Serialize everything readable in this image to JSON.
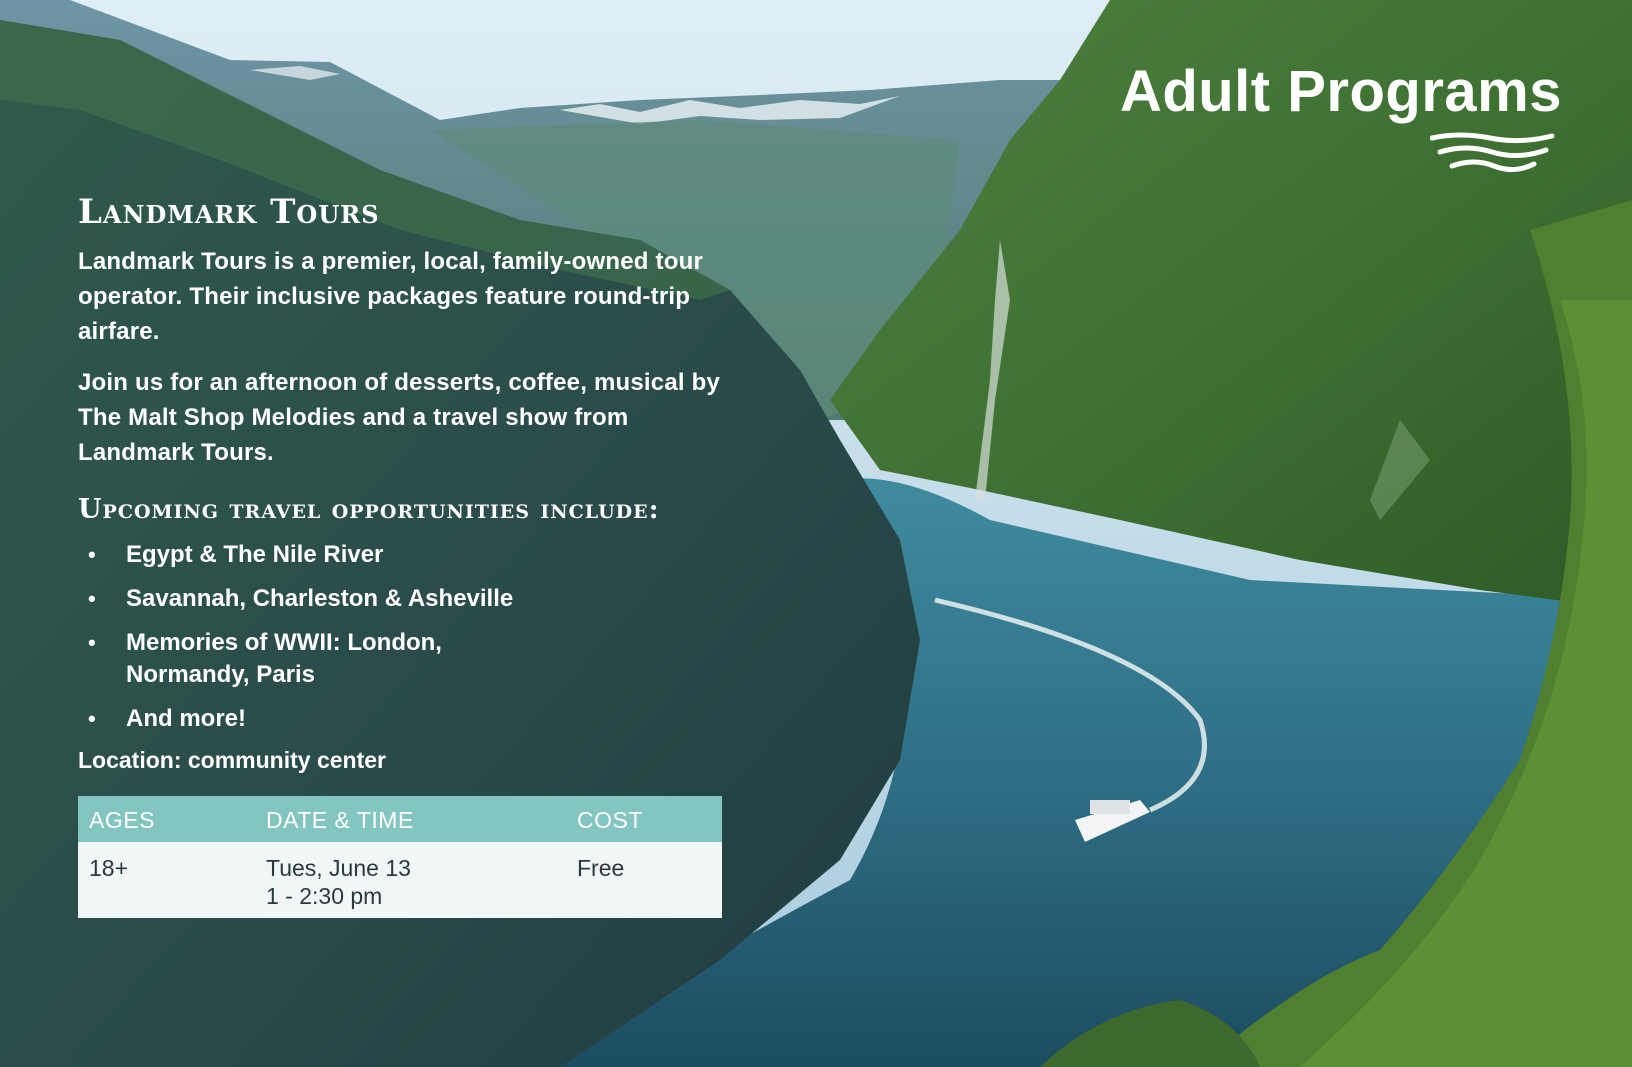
{
  "header": {
    "title": "Adult Programs"
  },
  "program": {
    "title": "Landmark Tours",
    "description": "Landmark Tours is a premier, local, family-owned tour operator. Their inclusive packages feature round-trip airfare.",
    "invitation": "Join us for an afternoon of desserts, coffee, musical by The Malt Shop Melodies and a travel show from Landmark Tours.",
    "opportunities_heading": "Upcoming travel opportunities include:",
    "opportunities": [
      "Egypt & The Nile River",
      "Savannah, Charleston & Asheville",
      "Memories of WWII: London, Normandy, Paris",
      "And more!"
    ],
    "location": "Location: community center"
  },
  "schedule_table": {
    "headers": {
      "ages": "AGES",
      "date_time": "DATE & TIME",
      "cost": "COST"
    },
    "row": {
      "ages": "18+",
      "date": "Tues, June 13",
      "time": "1 - 2:30 pm",
      "cost": "Free"
    }
  },
  "colors": {
    "table_header": "#83c5c0",
    "table_body": "#f1f7f7",
    "text": "#ffffff"
  },
  "icons": {
    "title_ornament": "waves-icon"
  }
}
